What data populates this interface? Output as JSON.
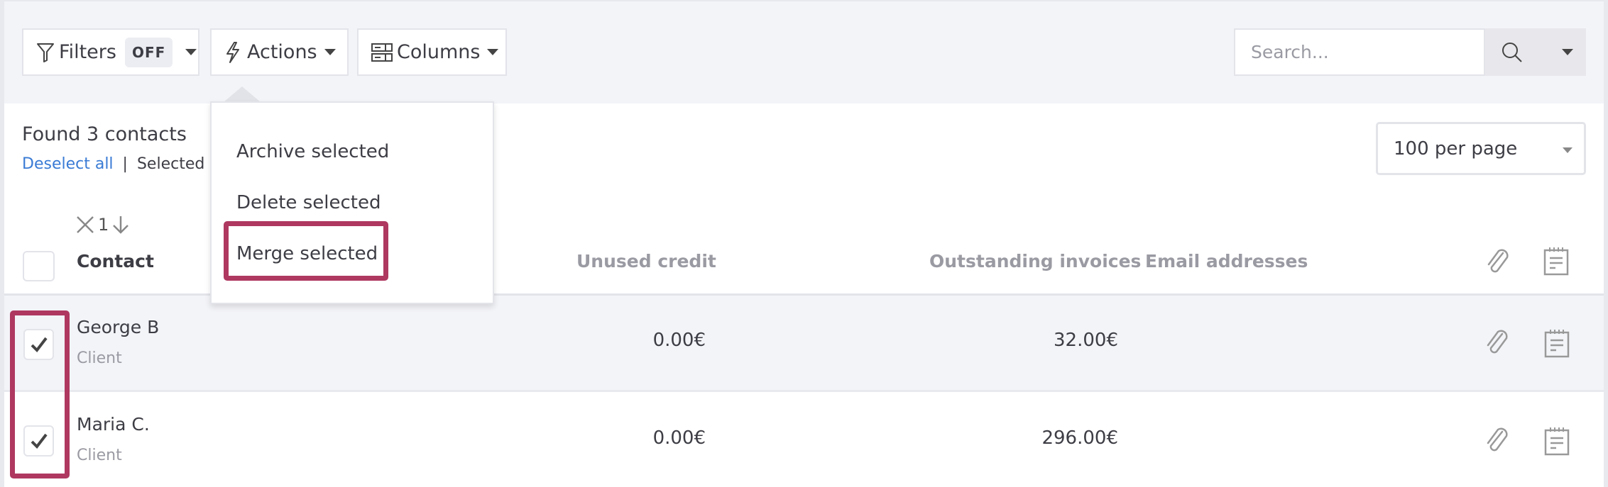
{
  "toolbar": {
    "filters_label": "Filters",
    "filters_state": "OFF",
    "actions_label": "Actions",
    "columns_label": "Columns",
    "search_placeholder": "Search..."
  },
  "actions_menu": {
    "items": [
      {
        "label": "Archive selected"
      },
      {
        "label": "Delete selected"
      },
      {
        "label": "Merge selected",
        "highlighted": true
      }
    ]
  },
  "summary": {
    "title": "Found 3 contacts",
    "deselect_label": "Deselect all",
    "separator": "|",
    "selected_text": "Selected re"
  },
  "pagination": {
    "per_page": "100 per page"
  },
  "sort": {
    "count": "1"
  },
  "table": {
    "columns": {
      "contact": "Contact",
      "unused_credit": "Unused credit",
      "outstanding_invoices": "Outstanding invoices",
      "email_addresses": "Email addresses"
    },
    "rows": [
      {
        "name": "George B",
        "type": "Client",
        "unused_credit": "0.00€",
        "outstanding": "32.00€",
        "email": "",
        "checked": true
      },
      {
        "name": "Maria C.",
        "type": "Client",
        "unused_credit": "0.00€",
        "outstanding": "296.00€",
        "email": "",
        "checked": true
      }
    ]
  },
  "colors": {
    "highlight": "#ae3860",
    "link": "#3a7bd5",
    "toolbar_bg": "#f3f4f8"
  }
}
